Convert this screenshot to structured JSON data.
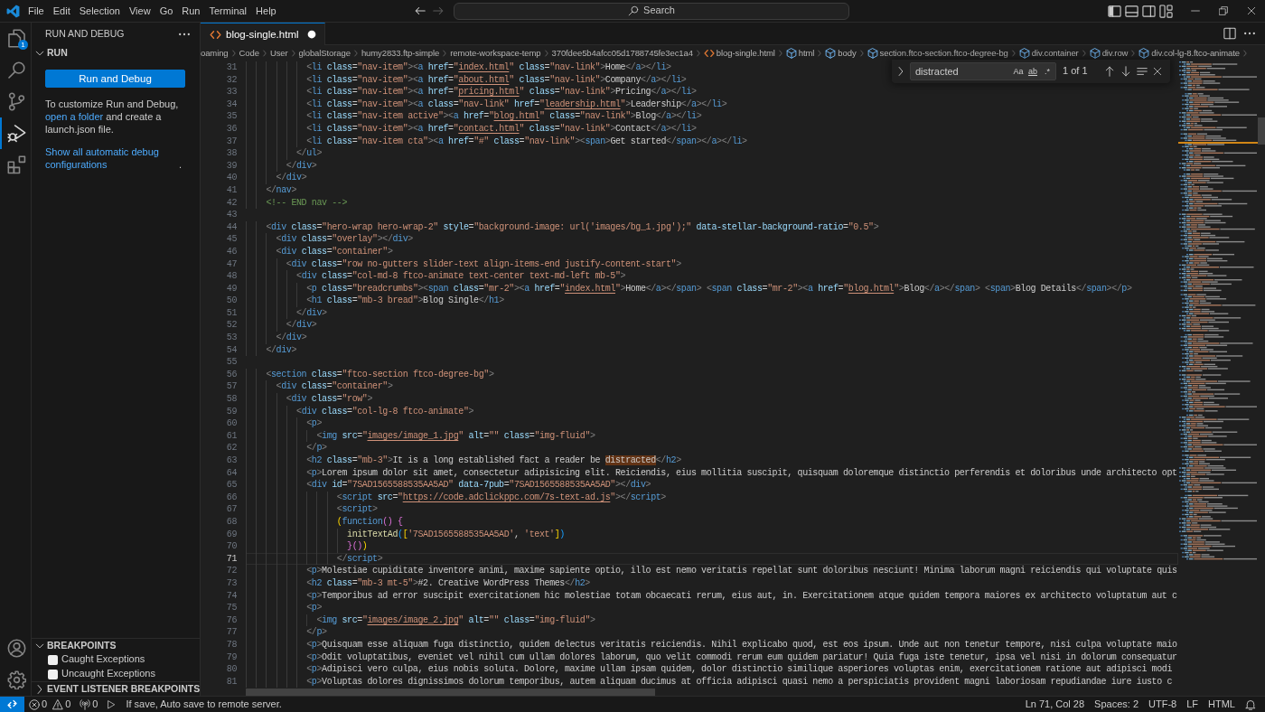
{
  "title_bar": {
    "menu": [
      "File",
      "Edit",
      "Selection",
      "View",
      "Go",
      "Run",
      "Terminal",
      "Help"
    ],
    "nav": [
      {
        "kind": "back",
        "disabled": false
      },
      {
        "kind": "forward",
        "disabled": true
      }
    ],
    "command_center": "Search",
    "layout": [
      {
        "kind": "primary_sidebar",
        "on": true
      },
      {
        "kind": "panel",
        "on": false
      },
      {
        "kind": "secondary_sidebar",
        "on": false
      },
      {
        "kind": "customize",
        "on": false
      }
    ],
    "window_controls": [
      {
        "kind": "minimize"
      },
      {
        "kind": "restore"
      },
      {
        "kind": "close"
      }
    ]
  },
  "activity_bar": {
    "items": [
      {
        "kind": "explorer",
        "selected": false,
        "badge": "1"
      },
      {
        "kind": "search",
        "selected": false
      },
      {
        "kind": "source_control",
        "selected": false
      },
      {
        "kind": "run_debug",
        "selected": true
      },
      {
        "kind": "extensions",
        "selected": false
      }
    ],
    "bottom": [
      {
        "kind": "account"
      },
      {
        "kind": "settings"
      }
    ]
  },
  "sidebar": {
    "title": "RUN AND DEBUG",
    "run": {
      "title": "RUN",
      "expanded": true,
      "button": "Run and Debug",
      "hint": {
        "before": "To customize Run and Debug, ",
        "link": "open a folder",
        "after": " and create a launch.json file."
      },
      "configs": {
        "link": "Show all automatic debug configurations",
        "after": "."
      }
    },
    "panels": [
      {
        "title": "BREAKPOINTS",
        "expanded": true,
        "items": [
          {
            "label": "Caught Exceptions",
            "checked": false
          },
          {
            "label": "Uncaught Exceptions",
            "checked": false
          }
        ]
      },
      {
        "title": "EVENT LISTENER BREAKPOINTS",
        "expanded": false
      }
    ]
  },
  "editor": {
    "tabs": [
      {
        "label": "blog-single.html",
        "selected": true,
        "modified": true
      }
    ],
    "breadcrumbs": [
      {
        "kind": "folder",
        "label": "oaming"
      },
      {
        "kind": "folder",
        "label": "Code"
      },
      {
        "kind": "folder",
        "label": "User"
      },
      {
        "kind": "folder",
        "label": "globalStorage"
      },
      {
        "kind": "folder",
        "label": "humy2833.ftp-simple"
      },
      {
        "kind": "folder",
        "label": "remote-workspace-temp"
      },
      {
        "kind": "folder",
        "label": "370fdee5b4afcc05d1788745fe3ec1a4"
      },
      {
        "kind": "file",
        "label": "blog-single.html"
      },
      {
        "kind": "element",
        "label": "html"
      },
      {
        "kind": "element",
        "label": "body"
      },
      {
        "kind": "element",
        "label": "section.ftco-section.ftco-degree-bg"
      },
      {
        "kind": "element",
        "label": "div.container"
      },
      {
        "kind": "element",
        "label": "div.row"
      },
      {
        "kind": "element",
        "label": "div.col-lg-8.ftco-animate"
      }
    ],
    "find": {
      "value": "distracted",
      "options": [
        {
          "kind": "case",
          "label": "Aa",
          "on": false
        },
        {
          "kind": "word",
          "label": "ab",
          "on": false
        },
        {
          "kind": "regex",
          "label": ".*",
          "on": false
        }
      ],
      "result": "1 of 1"
    },
    "lines": [
      {
        "number": "31",
        "kind": "html",
        "current": false,
        "parts": [
          {
            "kind": "code",
            "text": "            <li class=\"nav-item\"><a href=\""
          },
          {
            "kind": "link",
            "text": "index.html"
          },
          {
            "kind": "code",
            "text": "\" class=\"nav-link\">Home</a></li>"
          }
        ]
      },
      {
        "number": "32",
        "kind": "html",
        "current": false,
        "parts": [
          {
            "kind": "code",
            "text": "            <li class=\"nav-item\"><a href=\""
          },
          {
            "kind": "link",
            "text": "about.html"
          },
          {
            "kind": "code",
            "text": "\" class=\"nav-link\">Company</a></li>"
          }
        ]
      },
      {
        "number": "33",
        "kind": "html",
        "current": false,
        "parts": [
          {
            "kind": "code",
            "text": "            <li class=\"nav-item\"><a href=\""
          },
          {
            "kind": "link",
            "text": "pricing.html"
          },
          {
            "kind": "code",
            "text": "\" class=\"nav-link\">Pricing</a></li>"
          }
        ]
      },
      {
        "number": "34",
        "kind": "html",
        "current": false,
        "parts": [
          {
            "kind": "code",
            "text": "            <li class=\"nav-item\"><a class=\"nav-link\" href=\""
          },
          {
            "kind": "link",
            "text": "leadership.html"
          },
          {
            "kind": "code",
            "text": "\">Leadership</a></li>"
          }
        ]
      },
      {
        "number": "35",
        "kind": "html",
        "current": false,
        "parts": [
          {
            "kind": "code",
            "text": "            <li class=\"nav-item active\"><a href=\""
          },
          {
            "kind": "link",
            "text": "blog.html"
          },
          {
            "kind": "code",
            "text": "\" class=\"nav-link\">Blog</a></li>"
          }
        ]
      },
      {
        "number": "36",
        "kind": "html",
        "current": false,
        "parts": [
          {
            "kind": "code",
            "text": "            <li class=\"nav-item\"><a href=\""
          },
          {
            "kind": "link",
            "text": "contact.html"
          },
          {
            "kind": "code",
            "text": "\" class=\"nav-link\">Contact</a></li>"
          }
        ]
      },
      {
        "number": "37",
        "kind": "html",
        "current": false,
        "text": "            <li class=\"nav-item cta\"><a href=\"#\" class=\"nav-link\"><span>Get started</span></a></li>"
      },
      {
        "number": "38",
        "kind": "html",
        "current": false,
        "text": "          </ul>"
      },
      {
        "number": "39",
        "kind": "html",
        "current": false,
        "text": "        </div>"
      },
      {
        "number": "40",
        "kind": "html",
        "current": false,
        "text": "      </div>"
      },
      {
        "number": "41",
        "kind": "html",
        "current": false,
        "text": "    </nav>"
      },
      {
        "number": "42",
        "kind": "html",
        "current": false,
        "text": "    <!-- END nav -->"
      },
      {
        "number": "43",
        "kind": "html",
        "current": false
      },
      {
        "number": "44",
        "kind": "html",
        "current": false,
        "text": "    <div class=\"hero-wrap hero-wrap-2\" style=\"background-image: url('images/bg_1.jpg');\" data-stellar-background-ratio=\"0.5\">"
      },
      {
        "number": "45",
        "kind": "html",
        "current": false,
        "text": "      <div class=\"overlay\"></div>"
      },
      {
        "number": "46",
        "kind": "html",
        "current": false,
        "text": "      <div class=\"container\">"
      },
      {
        "number": "47",
        "kind": "html",
        "current": false,
        "text": "        <div class=\"row no-gutters slider-text align-items-end justify-content-start\">"
      },
      {
        "number": "48",
        "kind": "html",
        "current": false,
        "text": "          <div class=\"col-md-8 ftco-animate text-center text-md-left mb-5\">"
      },
      {
        "number": "49",
        "kind": "html",
        "current": false,
        "parts": [
          {
            "kind": "code",
            "text": "            <p class=\"breadcrumbs\"><span class=\"mr-2\"><a href=\""
          },
          {
            "kind": "link",
            "text": "index.html"
          },
          {
            "kind": "code",
            "text": "\">Home</a></span> <span class=\"mr-2\"><a href=\""
          },
          {
            "kind": "link",
            "text": "blog.html"
          },
          {
            "kind": "code",
            "text": "\">Blog</a></span> <span>Blog Details</span></p>"
          }
        ]
      },
      {
        "number": "50",
        "kind": "html",
        "current": false,
        "text": "            <h1 class=\"mb-3 bread\">Blog Single</h1>"
      },
      {
        "number": "51",
        "kind": "html",
        "current": false,
        "text": "          </div>"
      },
      {
        "number": "52",
        "kind": "html",
        "current": false,
        "text": "        </div>"
      },
      {
        "number": "53",
        "kind": "html",
        "current": false,
        "text": "      </div>"
      },
      {
        "number": "54",
        "kind": "html",
        "current": false,
        "text": "    </div>"
      },
      {
        "number": "55",
        "kind": "html",
        "current": false
      },
      {
        "number": "56",
        "kind": "html",
        "current": false,
        "text": "    <section class=\"ftco-section ftco-degree-bg\">"
      },
      {
        "number": "57",
        "kind": "html",
        "current": false,
        "text": "      <div class=\"container\">"
      },
      {
        "number": "58",
        "kind": "html",
        "current": false,
        "text": "        <div class=\"row\">"
      },
      {
        "number": "59",
        "kind": "html",
        "current": false,
        "text": "          <div class=\"col-lg-8 ftco-animate\">"
      },
      {
        "number": "60",
        "kind": "html",
        "current": false,
        "text": "            <p>"
      },
      {
        "number": "61",
        "kind": "html",
        "current": false,
        "parts": [
          {
            "kind": "code",
            "text": "              <img src=\""
          },
          {
            "kind": "link",
            "text": "images/image_1.jpg"
          },
          {
            "kind": "code",
            "text": "\" alt=\"\" class=\"img-fluid\">"
          }
        ]
      },
      {
        "number": "62",
        "kind": "html",
        "current": false,
        "text": "            </p>"
      },
      {
        "number": "63",
        "kind": "html",
        "current": false,
        "parts": [
          {
            "kind": "code",
            "text": "            <h2 class=\"mb-3\">It is a long established fact a reader be "
          },
          {
            "kind": "match",
            "text": "distracted"
          },
          {
            "kind": "code",
            "text": "</h2>"
          }
        ]
      },
      {
        "number": "64",
        "kind": "html",
        "current": false,
        "text": "            <p>Lorem ipsum dolor sit amet, consectetur adipisicing elit. Reiciendis, eius mollitia suscipit, quisquam doloremque distinctio perferendis et doloribus unde architecto opt"
      },
      {
        "number": "65",
        "kind": "html",
        "current": false,
        "text": "            <div id=\"7SAD1565588535AA5AD\" data-7pub=\"7SAD1565588535AA5AD\"></div>"
      },
      {
        "number": "66",
        "kind": "html",
        "current": false,
        "parts": [
          {
            "kind": "code",
            "text": "                  <script src=\""
          },
          {
            "kind": "link",
            "text": "https://code.adclickppc.com/7s-text-ad.js"
          },
          {
            "kind": "code",
            "text": "\"></script>"
          }
        ]
      },
      {
        "number": "67",
        "kind": "html",
        "current": false,
        "text": "                  <script>"
      },
      {
        "number": "68",
        "kind": "js",
        "current": false,
        "parts": [
          {
            "kind": "code",
            "text": "                  ("
          },
          {
            "kind": "keyword",
            "text": "function"
          },
          {
            "kind": "code",
            "text": "() {"
          }
        ]
      },
      {
        "number": "69",
        "kind": "js",
        "current": false,
        "text": "                    initTextAd(['7SAD1565588535AA5AD', 'text'])"
      },
      {
        "number": "70",
        "kind": "js",
        "current": false,
        "text": "                    }())"
      },
      {
        "number": "71",
        "kind": "html",
        "current": true,
        "text": "                  </script>"
      },
      {
        "number": "72",
        "kind": "html",
        "current": false,
        "text": "            <p>Molestiae cupiditate inventore animi, maxime sapiente optio, illo est nemo veritatis repellat sunt doloribus nesciunt! Minima laborum magni reiciendis qui voluptate quis"
      },
      {
        "number": "73",
        "kind": "html",
        "current": false,
        "text": "            <h2 class=\"mb-3 mt-5\">#2. Creative WordPress Themes</h2>"
      },
      {
        "number": "74",
        "kind": "html",
        "current": false,
        "text": "            <p>Temporibus ad error suscipit exercitationem hic molestiae totam obcaecati rerum, eius aut, in. Exercitationem atque quidem tempora maiores ex architecto voluptatum aut c"
      },
      {
        "number": "75",
        "kind": "html",
        "current": false,
        "text": "            <p>"
      },
      {
        "number": "76",
        "kind": "html",
        "current": false,
        "parts": [
          {
            "kind": "code",
            "text": "              <img src=\""
          },
          {
            "kind": "link",
            "text": "images/image_2.jpg"
          },
          {
            "kind": "code",
            "text": "\" alt=\"\" class=\"img-fluid\">"
          }
        ]
      },
      {
        "number": "77",
        "kind": "html",
        "current": false,
        "text": "            </p>"
      },
      {
        "number": "78",
        "kind": "html",
        "current": false,
        "text": "            <p>Quisquam esse aliquam fuga distinctio, quidem delectus veritatis reiciendis. Nihil explicabo quod, est eos ipsum. Unde aut non tenetur tempore, nisi culpa voluptate maio"
      },
      {
        "number": "79",
        "kind": "html",
        "current": false,
        "text": "            <p>Odit voluptatibus, eveniet vel nihil cum ullam dolores laborum, quo velit commodi rerum eum quidem pariatur! Quia fuga iste tenetur, ipsa vel nisi in dolorum consequatur"
      },
      {
        "number": "80",
        "kind": "html",
        "current": false,
        "text": "            <p>Adipisci vero culpa, eius nobis soluta. Dolore, maxime ullam ipsam quidem, dolor distinctio similique asperiores voluptas enim, exercitationem ratione aut adipisci modi"
      },
      {
        "number": "81",
        "kind": "html",
        "current": false,
        "text": "            <p>Voluptas dolores dignissimos dolorum temporibus, autem aliquam ducimus at officia adipisci quasi nemo a perspiciatis provident magni laboriosam repudiandae iure iusto c"
      }
    ]
  },
  "status_bar": {
    "errors": "0",
    "warnings": "0",
    "ports": "0",
    "message": "If save, Auto save to remote server.",
    "items": [
      "Ln 71, Col 28",
      "Spaces: 2",
      "UTF-8",
      "LF",
      "HTML"
    ]
  }
}
